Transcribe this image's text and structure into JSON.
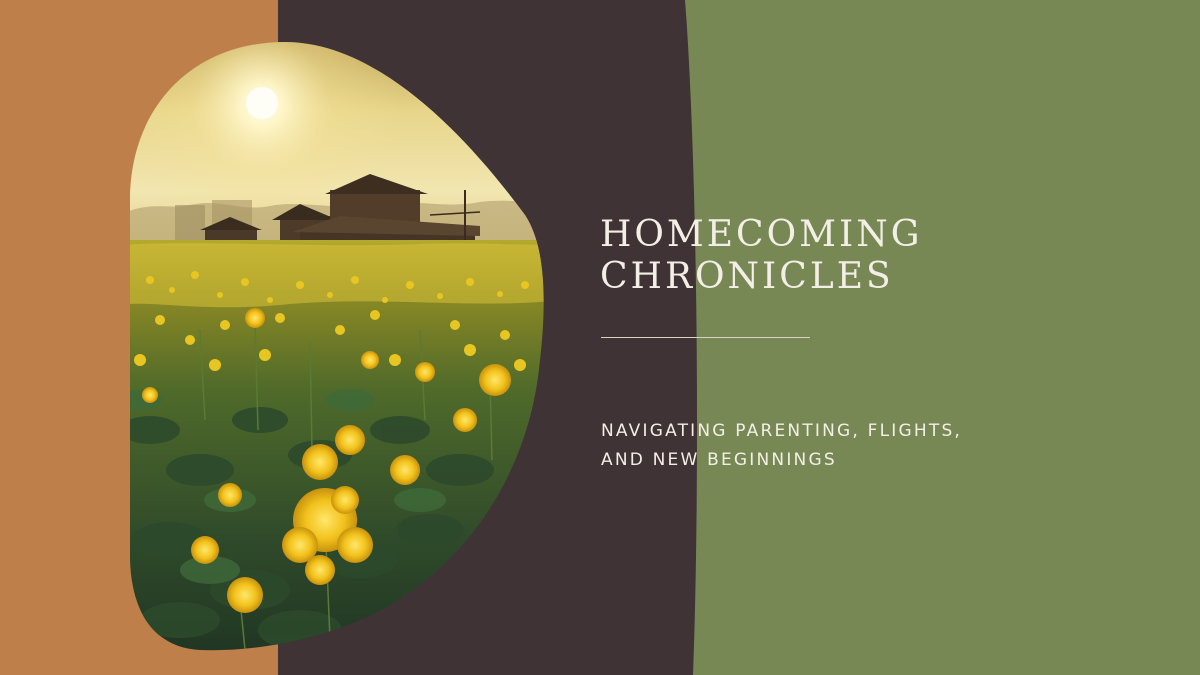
{
  "slide": {
    "title_lines": [
      "HOMECOMING",
      "CHRONICLES"
    ],
    "subtitle_lines": [
      "NAVIGATING PARENTING, FLIGHTS,",
      "AND NEW BEGINNINGS"
    ]
  },
  "colors": {
    "terracotta": "#bf7f4b",
    "dark_plum": "#3f3335",
    "olive_green": "#778855",
    "text": "#f3efe6",
    "divider": "#d8d2c3"
  },
  "image": {
    "subject": "sunlit mustard flower field with wooden farmhouse",
    "icon": "landscape-photo"
  }
}
